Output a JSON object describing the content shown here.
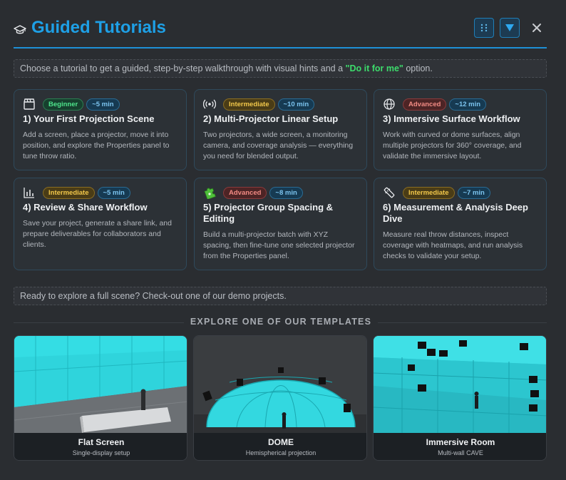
{
  "header": {
    "title": "Guided Tutorials",
    "title_icon": "graduation-cap-icon",
    "grid_icon": "grid-dots-icon",
    "filter_icon": "filter-triangle-icon",
    "close_icon": "close-icon",
    "accent": "#1ea0e6"
  },
  "intro": {
    "text_before": "Choose a tutorial to get a guided, step-by-step walkthrough with visual hints and a ",
    "highlight": "\"Do it for me\"",
    "text_after": " option."
  },
  "tutorials": [
    {
      "icon": "clapperboard-icon",
      "level": "Beginner",
      "time": "~5 min",
      "title": "1) Your First Projection Scene",
      "desc": "Add a screen, place a projector, move it into position, and explore the Properties panel to tune throw ratio."
    },
    {
      "icon": "broadcast-icon",
      "level": "Intermediate",
      "time": "~10 min",
      "title": "2) Multi-Projector Linear Setup",
      "desc": "Two projectors, a wide screen, a monitoring camera, and coverage analysis — everything you need for blended output."
    },
    {
      "icon": "globe-icon",
      "level": "Advanced",
      "time": "~12 min",
      "title": "3) Immersive Surface Workflow",
      "desc": "Work with curved or dome surfaces, align multiple projectors for 360° coverage, and validate the immersive layout."
    },
    {
      "icon": "bar-chart-icon",
      "level": "Intermediate",
      "time": "~5 min",
      "title": "4) Review & Share Workflow",
      "desc": "Save your project, generate a share link, and prepare deliverables for collaborators and clients."
    },
    {
      "icon": "puzzle-icon",
      "level": "Advanced",
      "time": "~8 min",
      "title": "5) Projector Group Spacing & Editing",
      "desc": "Build a multi-projector batch with XYZ spacing, then fine-tune one selected projector from the Properties panel."
    },
    {
      "icon": "ruler-icon",
      "level": "Intermediate",
      "time": "~7 min",
      "title": "6) Measurement & Analysis Deep Dive",
      "desc": "Measure real throw distances, inspect coverage with heatmaps, and run analysis checks to validate your setup."
    }
  ],
  "demo_prompt": "Ready to explore a full scene? Check-out one of our demo projects.",
  "templates_heading": "EXPLORE ONE OF OUR TEMPLATES",
  "templates": [
    {
      "name": "Flat Screen",
      "subtitle": "Single-display setup"
    },
    {
      "name": "DOME",
      "subtitle": "Hemispherical projection"
    },
    {
      "name": "Immersive Room",
      "subtitle": "Multi-wall CAVE"
    }
  ],
  "colors": {
    "beginner": "#4ee58c",
    "intermediate": "#f2c84b",
    "advanced": "#f28b84",
    "time": "#7cc4ef",
    "highlight": "#3ddc6c",
    "projection_cyan": "#2fe0e8"
  }
}
